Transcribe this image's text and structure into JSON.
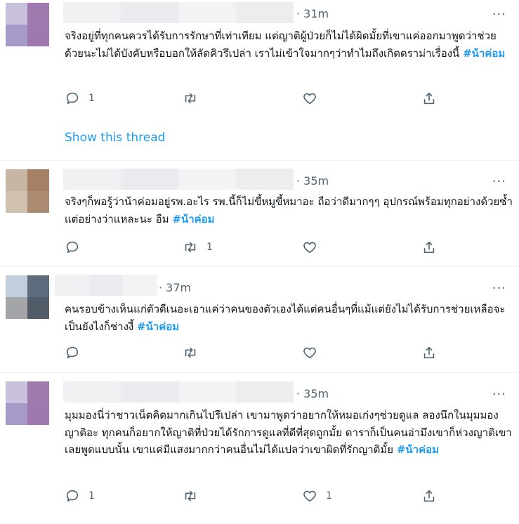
{
  "tweets": [
    {
      "time": "· 31m",
      "more": "···",
      "text": "จริงอยู่ที่ทุกคนควรได้รับการรักษาที่เท่าเทียม แต่ญาติผู้ป่วยก็ไม่ได้ผิดมั้ยที่เขาแค่ออกมาพูดว่าช่วยด้วยนะไม่ได้บังคับหรือบอกให้ลัดคิวรึเปล่า เราไม่เข้าใจมากๆว่าทำไมถึงเกิดดราม่าเรื่องนี้",
      "hashtag": "#น้าค่อม",
      "reply_count": "1",
      "retweet_count": "",
      "like_count": "",
      "show_thread": "Show this thread"
    },
    {
      "time": "· 35m",
      "more": "···",
      "text": "จริงๆก็พอรู้ว่าน้าค่อมอยู่รพ.อะไร รพ.นี้ก็ไม่ขี้หมูขี้หมาอะ ถือว่าดีมากๆๆ อุปกรณ์พร้อมทุกอย่างด้วยซ้ำ แต่อย่างว่าแหละนะ อืม",
      "hashtag": "#น้าค่อม",
      "reply_count": "",
      "retweet_count": "1",
      "like_count": ""
    },
    {
      "time": "· 37m",
      "more": "···",
      "text": "คนรอบข้างเห็นแก่ตัวดีเนอะเอาแค่ว่าคนของตัวเองได้แต่คนอื่นๆที่แม้แต่ยังไม่ได้รับการช่วยเหลือจะเป็นยังไงก็ช่างงี้",
      "hashtag": "#น้าค่อม",
      "reply_count": "",
      "retweet_count": "",
      "like_count": ""
    },
    {
      "time": "· 35m",
      "more": "···",
      "text": "มุมมองนี่ว่าชาวเน็ตคิดมากเกินไปรึเปล่า เขามาพูดว่าอยากให้หมอเก่งๆช่วยดูแล ลองนึกในมุมมองญาติอะ ทุกคนก็อยากให้ญาติที่ป่วยได้รักการดูแลที่ดีที่สุดถูกมั้ย ดาราก็เป็นคนอ่ามึงเขาก็ห่วงญาติเขาเลยพูดแบบนั้น เขาแค่มีแสงมากกว่าคนอื่นไม่ได้แปลว่าเขาผิดที่รักญาติมั้ย",
      "hashtag": "#น้าค่อม",
      "reply_count": "1",
      "retweet_count": "",
      "like_count": "1"
    }
  ],
  "colors": {
    "accent": "#1d9bf0",
    "muted": "#536471",
    "text": "#0f1419",
    "divider": "#eff3f4"
  },
  "icons": [
    "reply-icon",
    "retweet-icon",
    "like-icon",
    "share-icon",
    "more-icon"
  ]
}
